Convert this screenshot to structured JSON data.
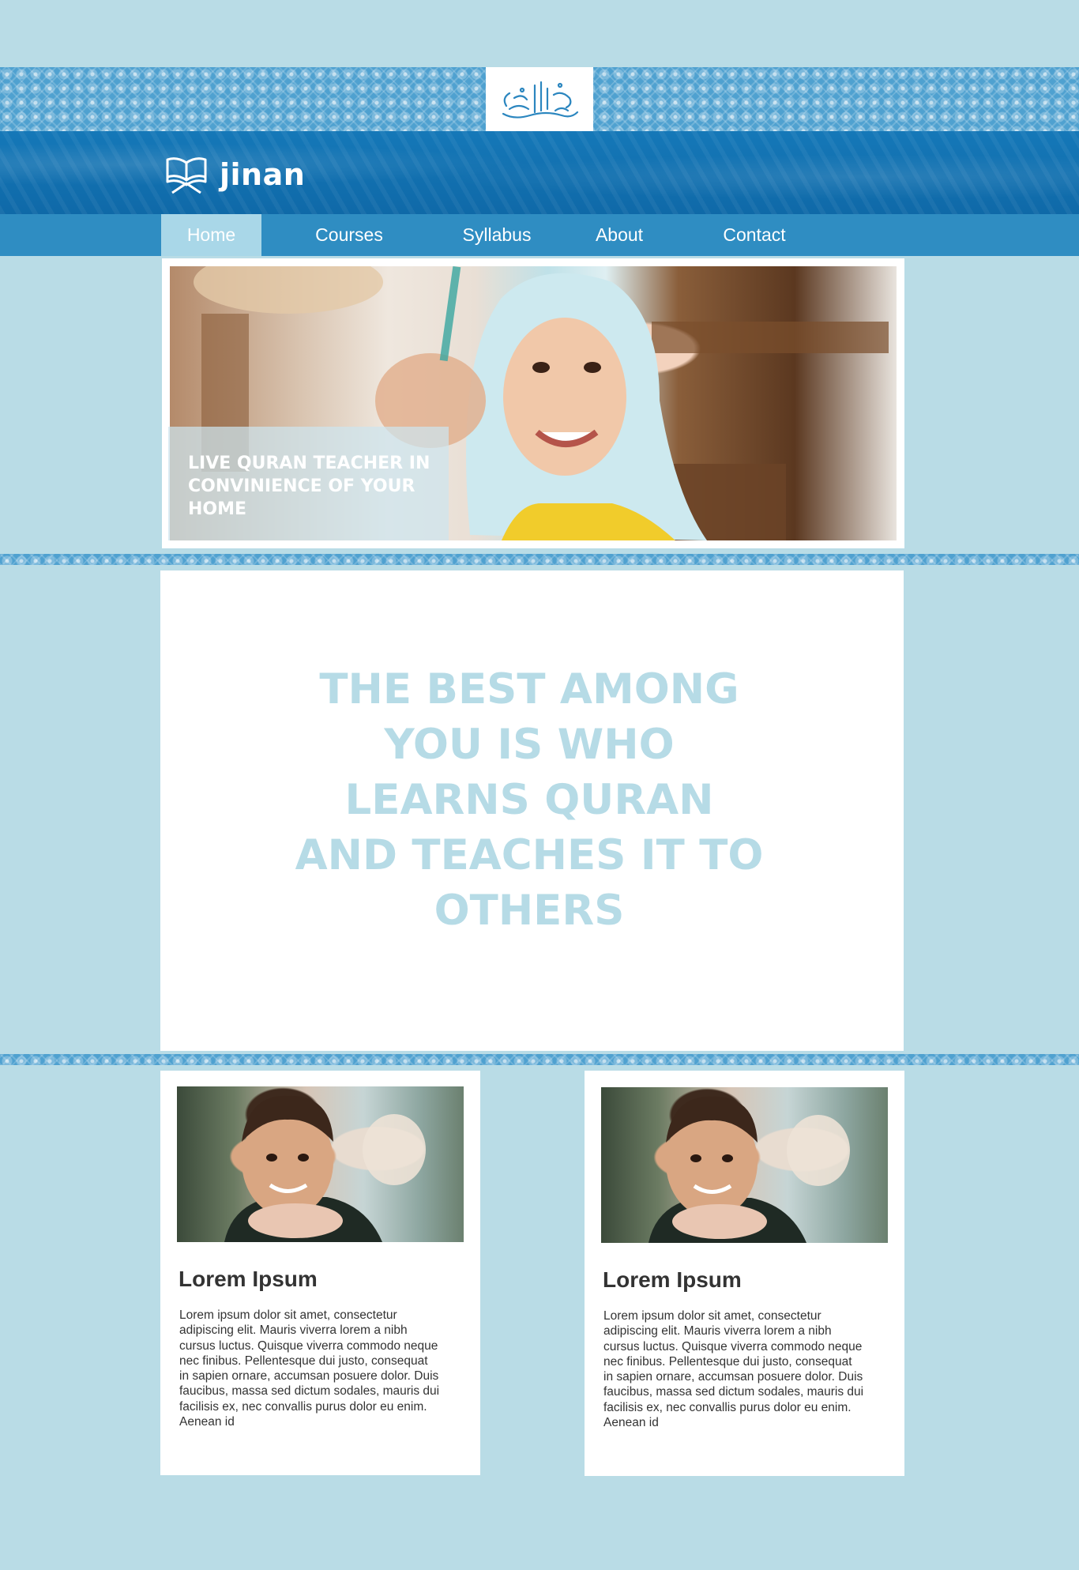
{
  "brand": {
    "name": "jinan",
    "logo_icon": "open-quran-book-icon",
    "calligraphy_icon": "bismillah-calligraphy-icon"
  },
  "nav": {
    "items": [
      {
        "label": "Home",
        "active": true
      },
      {
        "label": "Courses",
        "active": false
      },
      {
        "label": "Syllabus",
        "active": false
      },
      {
        "label": "About",
        "active": false
      },
      {
        "label": "Contact",
        "active": false
      }
    ]
  },
  "hero": {
    "caption_line1": "LIVE QURAN TEACHER IN",
    "caption_line2": "CONVINIENCE OF YOUR",
    "caption_line3": "HOME"
  },
  "quote": {
    "line1": "THE BEST AMONG",
    "line2": "YOU IS WHO",
    "line3": "LEARNS QURAN",
    "line4": "AND TEACHES IT TO",
    "line5": "OTHERS"
  },
  "cards": [
    {
      "title": "Lorem Ipsum",
      "body": "Lorem ipsum dolor sit amet, consectetur adipiscing elit. Mauris viverra lorem a nibh cursus luctus. Quisque viverra commodo neque nec finibus. Pellentesque dui justo, consequat in sapien ornare, accumsan posuere dolor. Duis faucibus, massa sed dictum sodales, mauris dui facilisis ex, nec convallis purus dolor eu enim. Aenean id"
    },
    {
      "title": "Lorem Ipsum",
      "body": "Lorem ipsum dolor sit amet, consectetur adipiscing elit. Mauris viverra lorem a nibh cursus luctus. Quisque viverra commodo neque nec finibus. Pellentesque dui justo, consequat in sapien ornare, accumsan posuere dolor. Duis faucibus, massa sed dictum sodales, mauris dui facilisis ex, nec convallis purus dolor eu enim. Aenean id"
    }
  ],
  "colors": {
    "page_background": "#b9dce6",
    "header_blue": "#1373b4",
    "nav_blue": "#2f8dc2",
    "nav_active": "#a9d7e8",
    "quote_text": "#b6dbe6"
  }
}
